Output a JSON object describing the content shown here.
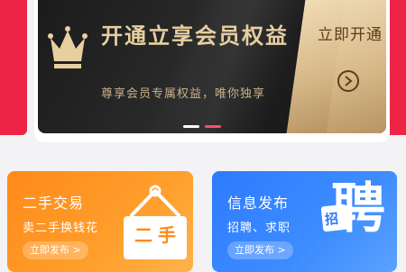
{
  "banner": {
    "title": "开通立享会员权益",
    "subtitle": "尊享会员专属权益，唯你独享",
    "join_label": "立即开通"
  },
  "cards": [
    {
      "title": "二手交易",
      "subtitle": "卖二手换钱花",
      "button": "立即发布 >",
      "sign_text": "二手"
    },
    {
      "title": "信息发布",
      "subtitle": "招聘、求职",
      "button": "立即发布 >",
      "big_char": "聘",
      "badge_char": "招"
    }
  ],
  "colors": {
    "accent_red": "#ee2447",
    "gold": "#e8cfa0",
    "orange": "#ff8a1a",
    "blue": "#2e7bff"
  },
  "carousel": {
    "active_index": 1,
    "count": 2
  }
}
